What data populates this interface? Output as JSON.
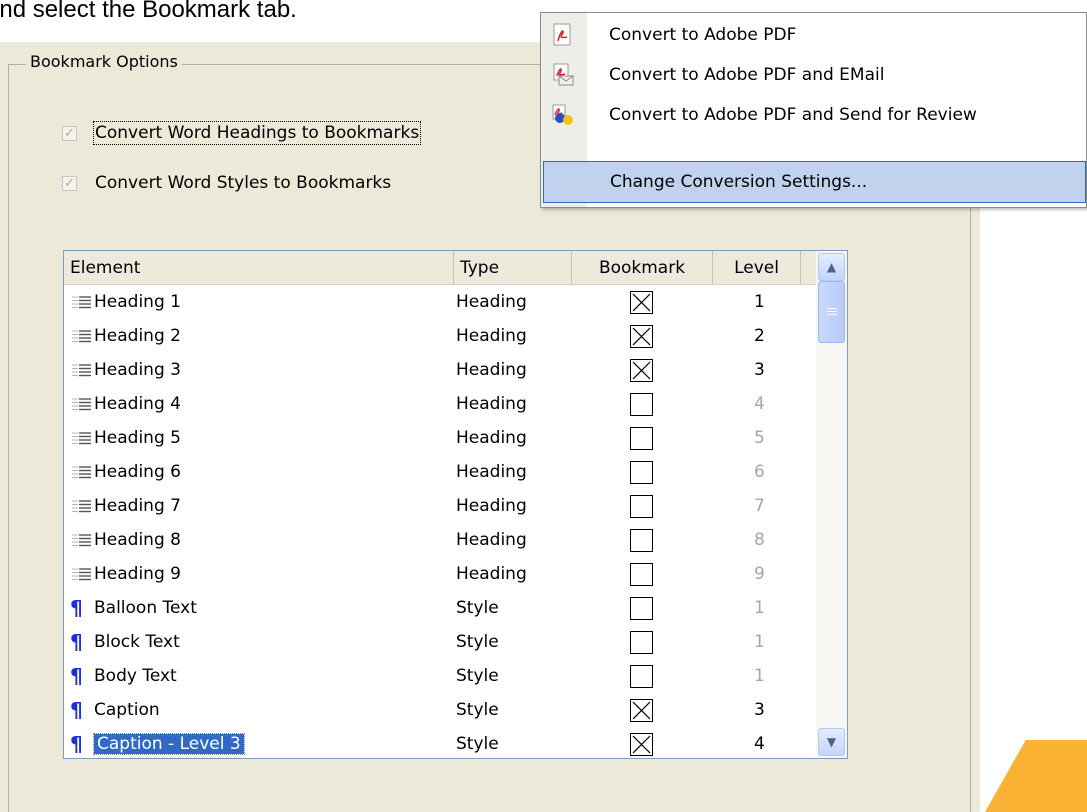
{
  "instruction_text": "and select the Bookmark tab.",
  "menu": {
    "items": [
      {
        "label": "Convert to Adobe PDF",
        "icon": "pdf-icon"
      },
      {
        "label": "Convert to Adobe PDF and EMail",
        "icon": "pdf-email-icon"
      },
      {
        "label": "Convert to Adobe PDF and Send for Review",
        "icon": "pdf-review-icon"
      },
      {
        "label": "Change Conversion Settings...",
        "icon": null,
        "highlighted": true
      }
    ]
  },
  "dialog": {
    "group_label": "Bookmark Options",
    "checkboxes": [
      {
        "label": "Convert Word Headings to Bookmarks",
        "checked": true,
        "disabled": true
      },
      {
        "label": "Convert Word Styles to Bookmarks",
        "checked": true,
        "disabled": true
      }
    ]
  },
  "table": {
    "columns": [
      "Element",
      "Type",
      "Bookmark",
      "Level"
    ],
    "rows": [
      {
        "element": "Heading 1",
        "type": "Heading",
        "bookmark": true,
        "level": "1",
        "kind": "heading"
      },
      {
        "element": "Heading 2",
        "type": "Heading",
        "bookmark": true,
        "level": "2",
        "kind": "heading"
      },
      {
        "element": "Heading 3",
        "type": "Heading",
        "bookmark": true,
        "level": "3",
        "kind": "heading"
      },
      {
        "element": "Heading 4",
        "type": "Heading",
        "bookmark": false,
        "level": "4",
        "kind": "heading"
      },
      {
        "element": "Heading 5",
        "type": "Heading",
        "bookmark": false,
        "level": "5",
        "kind": "heading"
      },
      {
        "element": "Heading 6",
        "type": "Heading",
        "bookmark": false,
        "level": "6",
        "kind": "heading"
      },
      {
        "element": "Heading 7",
        "type": "Heading",
        "bookmark": false,
        "level": "7",
        "kind": "heading"
      },
      {
        "element": "Heading 8",
        "type": "Heading",
        "bookmark": false,
        "level": "8",
        "kind": "heading"
      },
      {
        "element": "Heading 9",
        "type": "Heading",
        "bookmark": false,
        "level": "9",
        "kind": "heading"
      },
      {
        "element": "Balloon Text",
        "type": "Style",
        "bookmark": false,
        "level": "1",
        "kind": "style"
      },
      {
        "element": "Block Text",
        "type": "Style",
        "bookmark": false,
        "level": "1",
        "kind": "style"
      },
      {
        "element": "Body Text",
        "type": "Style",
        "bookmark": false,
        "level": "1",
        "kind": "style"
      },
      {
        "element": "Caption",
        "type": "Style",
        "bookmark": true,
        "level": "3",
        "kind": "style"
      },
      {
        "element": "Caption - Level 3",
        "type": "Style",
        "bookmark": true,
        "level": "4",
        "kind": "style",
        "selected": true
      }
    ]
  },
  "colors": {
    "dialog_bg": "#ECE9D8",
    "selection": "#316AC5",
    "menu_highlight": "#C1D2EE",
    "paragraph_mark": "#1C2FD8",
    "accent_orange": "#F9B233"
  }
}
